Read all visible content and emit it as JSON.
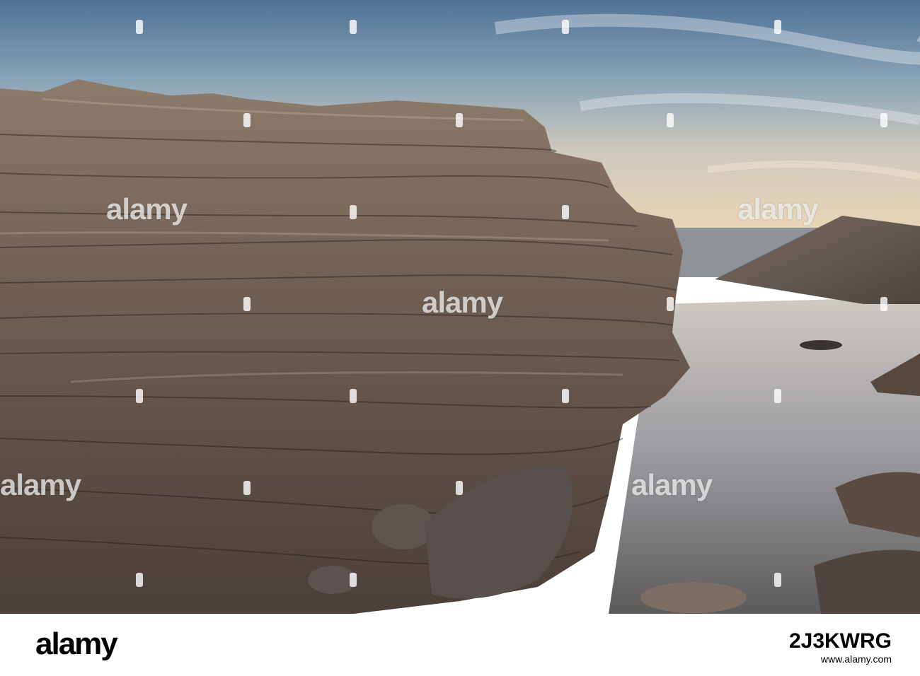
{
  "photo": {
    "description_alt": "",
    "sky_top": "#4f7296",
    "sky_bottom": "#e8d6b8",
    "sea": "#8a8f94",
    "rock": "#6e5e52",
    "water": "#a9a8a6"
  },
  "watermark": {
    "text": "alamy"
  },
  "footer": {
    "logo": "alamy",
    "image_id": "2J3KWRG",
    "url": "www.alamy.com"
  }
}
